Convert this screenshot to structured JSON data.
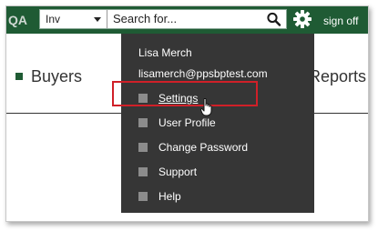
{
  "header": {
    "logo_text": "QA",
    "scope_value": "Inv",
    "search_placeholder": "Search for...",
    "signoff_label": "sign off"
  },
  "nav": {
    "buyers_label": "Buyers",
    "reports_label": "Reports"
  },
  "user_menu": {
    "user_name": "Lisa Merch",
    "user_email": "lisamerch@ppsbptest.com",
    "items": [
      {
        "label": "Settings",
        "icon": "square-bullet-icon",
        "active": true
      },
      {
        "label": "User Profile",
        "icon": "square-bullet-icon"
      },
      {
        "label": "Change Password",
        "icon": "square-bullet-icon"
      },
      {
        "label": "Support",
        "icon": "square-bullet-icon"
      },
      {
        "label": "Help",
        "icon": "square-bullet-icon"
      }
    ]
  },
  "colors": {
    "topbar": "#1f5b34",
    "menu_background": "#363636",
    "highlight_border": "#d02028",
    "bullet": "#8c8c8c"
  },
  "icons": {
    "search": "magnifier-icon",
    "settings": "gear-icon",
    "cursor": "hand-pointer-icon"
  }
}
